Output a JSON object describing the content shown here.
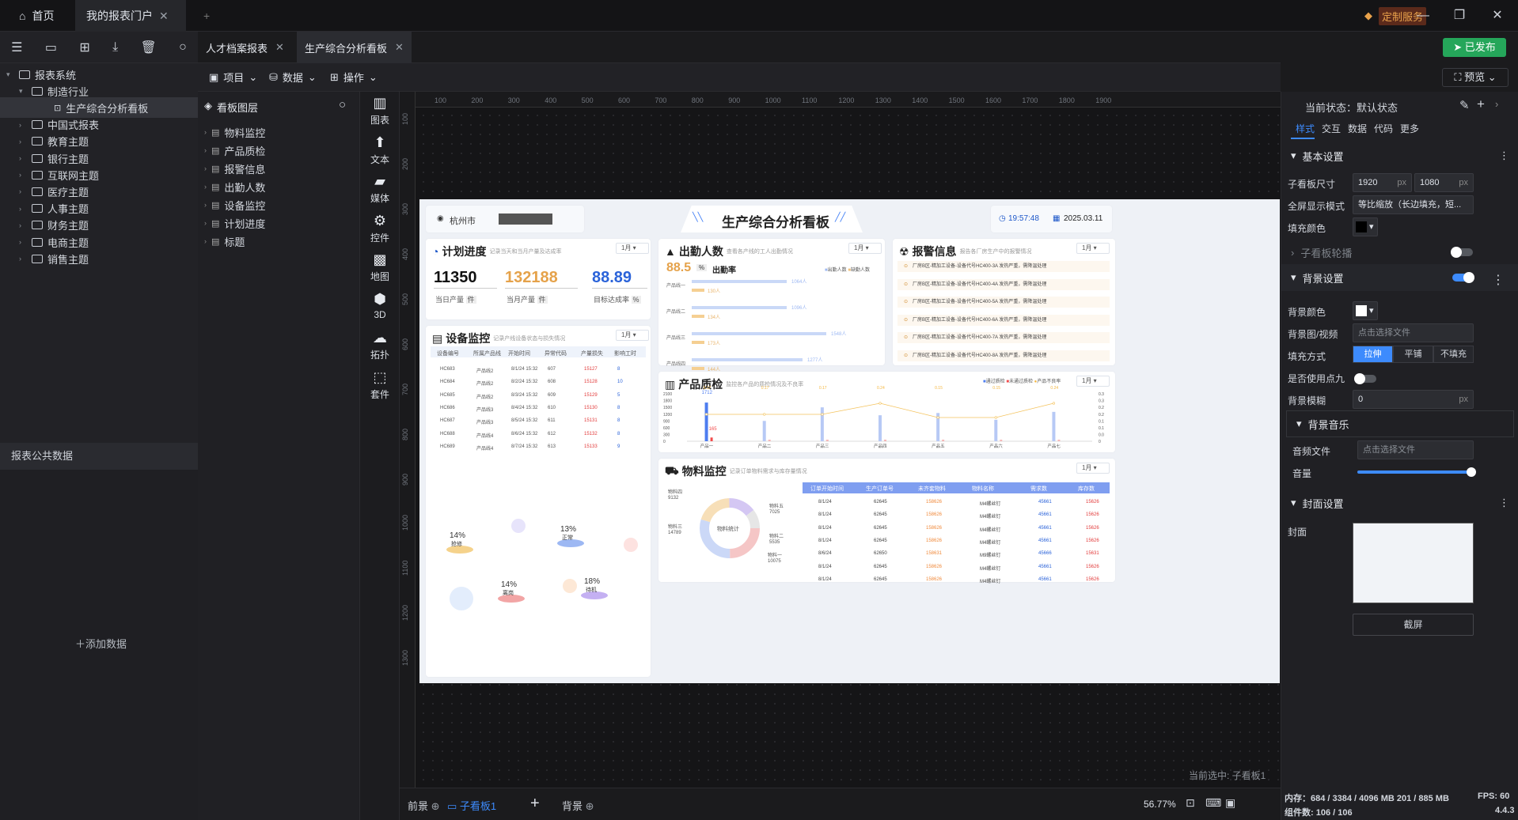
{
  "titlebar": {
    "home": "首页",
    "tab": "我的报表门户",
    "custom": "定制服务"
  },
  "toolbar_left": {
    "icons": [
      "menu-icon",
      "folder-add-icon",
      "file-add-icon",
      "download-icon",
      "trash-icon",
      "search-icon"
    ]
  },
  "tree": {
    "root": "报表系统",
    "manu": "制造行业",
    "current": "生产综合分析看板",
    "items": [
      "中国式报表",
      "教育主题",
      "银行主题",
      "互联网主题",
      "医疗主题",
      "人事主题",
      "财务主题",
      "电商主题",
      "销售主题"
    ]
  },
  "public": {
    "title": "报表公共数据",
    "add": "添加数据"
  },
  "doc": {
    "tabs": [
      "人才档案报表",
      "生产综合分析看板"
    ],
    "publish": "已发布",
    "preview": "预览"
  },
  "menu": {
    "items": [
      "项目",
      "数据",
      "操作"
    ]
  },
  "layers": {
    "title": "看板图层",
    "items": [
      "物料监控",
      "产品质检",
      "报警信息",
      "出勤人数",
      "设备监控",
      "计划进度",
      "标题"
    ]
  },
  "components": [
    "图表",
    "文本",
    "媒体",
    "控件",
    "地图",
    "3D",
    "拓扑",
    "套件"
  ],
  "ruler": {
    "h": [
      "100",
      "200",
      "300",
      "400",
      "500",
      "600",
      "700",
      "800",
      "900",
      "1000",
      "1100",
      "1200",
      "1300",
      "1400",
      "1500",
      "1600",
      "1700",
      "1800",
      "1900"
    ],
    "v": [
      "100",
      "200",
      "300",
      "400",
      "500",
      "600",
      "700",
      "800",
      "900",
      "1000",
      "1100",
      "1200",
      "1300"
    ]
  },
  "dashboard": {
    "city": "杭州市",
    "title": "生产综合分析看板",
    "time": "19:57:48",
    "date": "2025.03.11",
    "month": "1月",
    "plan": {
      "title": "计划进度",
      "sub": "记录当天和当月产量及达成率",
      "v1": "11350",
      "l1": "当日产量",
      "u1": "件",
      "v2": "132188",
      "l2": "当月产量",
      "u2": "件",
      "v3": "88.89",
      "l3": "目标达成率",
      "u3": "%"
    },
    "attendance": {
      "title": "出勤人数",
      "sub": "查看各产线的工人出勤情况",
      "rate": "88.5",
      "pct": "%",
      "rate_label": "出勤率",
      "legend": [
        "出勤人数",
        "缺勤人数"
      ],
      "lines": [
        {
          "name": "产品线一",
          "v1": "1064人",
          "v2": "130人"
        },
        {
          "name": "产品线二",
          "v1": "1096人",
          "v2": "134人"
        },
        {
          "name": "产品线三",
          "v1": "1548人",
          "v2": "173人"
        },
        {
          "name": "产品线四",
          "v1": "1277人",
          "v2": "144人"
        }
      ]
    },
    "alarm": {
      "title": "报警信息",
      "sub": "报告各厂房生产中的报警情况",
      "rows": [
        "厂房B区-精加工设备-设备代号HC400-3A 发热严重，需降温处理",
        "厂房B区-精加工设备-设备代号HC400-4A 发热严重，需降温处理",
        "厂房B区-精加工设备-设备代号HC400-5A 发热严重，需降温处理",
        "厂房B区-精加工设备-设备代号HC400-6A 发热严重，需降温处理",
        "厂房B区-精加工设备-设备代号HC400-7A 发热严重，需降温处理",
        "厂房B区-精加工设备-设备代号HC400-8A 发热严重，需降温处理"
      ]
    },
    "device": {
      "title": "设备监控",
      "sub": "记录产线设备状态与损失情况",
      "headers": [
        "设备编号",
        "所属产品线",
        "开始时间",
        "异常代码",
        "产量损失",
        "影响工时"
      ],
      "rows": [
        [
          "HC683",
          "产品线2",
          "8/1/24 15:32",
          "607",
          "15127",
          "8"
        ],
        [
          "HC684",
          "产品线2",
          "8/2/24 15:32",
          "608",
          "15128",
          "10"
        ],
        [
          "HC685",
          "产品线2",
          "8/3/24 15:32",
          "609",
          "15129",
          "5"
        ],
        [
          "HC686",
          "产品线3",
          "8/4/24 15:32",
          "610",
          "15130",
          "8"
        ],
        [
          "HC687",
          "产品线3",
          "8/5/24 15:32",
          "611",
          "15131",
          "8"
        ],
        [
          "HC688",
          "产品线4",
          "8/6/24 15:32",
          "612",
          "15132",
          "8"
        ],
        [
          "HC689",
          "产品线4",
          "8/7/24 15:32",
          "613",
          "15133",
          "9"
        ]
      ],
      "bubbles": [
        {
          "p": "14%",
          "n": "抢修"
        },
        {
          "p": "13%",
          "n": "正常"
        },
        {
          "p": "14%",
          "n": "离岗"
        },
        {
          "p": "18%",
          "n": "待机"
        }
      ]
    },
    "quality": {
      "title": "产品质检",
      "sub": "监控各产品的质检情况及不良率",
      "legend": [
        "通过质检",
        "未通过质检",
        "产品不良率"
      ],
      "yl": [
        "2100",
        "1800",
        "1500",
        "1200",
        "900",
        "600",
        "300",
        "0"
      ],
      "yr": [
        "0.3",
        "0.3",
        "0.2",
        "0.2",
        "0.1",
        "0.1",
        "0.0",
        "0"
      ],
      "x": [
        "产品一",
        "产品二",
        "产品三",
        "产品四",
        "产品五",
        "产品六",
        "产品七"
      ],
      "top_label": "1712",
      "low_label": "165",
      "rates": [
        "0.17",
        "0.17",
        "0.17",
        "0.24",
        "0.15",
        "0.15",
        "0.24"
      ],
      "pass": [
        1712,
        900,
        1500,
        1150,
        1250,
        950,
        1300
      ],
      "fail": [
        165,
        30,
        50,
        40,
        60,
        50,
        55
      ],
      "rate_vals": [
        0.17,
        0.17,
        0.17,
        0.24,
        0.15,
        0.15,
        0.24
      ]
    },
    "material": {
      "title": "物料监控",
      "sub": "记录订单物料需求与库存量情况",
      "donut_center": "物料统计",
      "labels": [
        "物料四 9132",
        "物料三 14789",
        "物料五 7025",
        "物料二 5535",
        "物料一 10075"
      ],
      "headers": [
        "订单开始时间",
        "生产订单号",
        "未齐套物料",
        "物料名称",
        "需求数",
        "库存数"
      ],
      "rows": [
        [
          "8/1/24",
          "62645",
          "158626",
          "M4螺丝钉",
          "45661",
          "15626"
        ],
        [
          "8/1/24",
          "62645",
          "158626",
          "M4螺丝钉",
          "45661",
          "15626"
        ],
        [
          "8/1/24",
          "62645",
          "158626",
          "M4螺丝钉",
          "45661",
          "15626"
        ],
        [
          "8/1/24",
          "62645",
          "158626",
          "M4螺丝钉",
          "45661",
          "15626"
        ],
        [
          "8/6/24",
          "62650",
          "158631",
          "M9螺丝钉",
          "45666",
          "15631"
        ],
        [
          "8/1/24",
          "62645",
          "158626",
          "M4螺丝钉",
          "45661",
          "15626"
        ],
        [
          "8/1/24",
          "62645",
          "158626",
          "M4螺丝钉",
          "45661",
          "15626"
        ]
      ]
    }
  },
  "canvas": {
    "selected": "当前选中: 子看板1"
  },
  "bottombar": {
    "tabs": [
      "前景",
      "子看板1",
      "背景"
    ],
    "zoom": "56.77%",
    "memory": "内存：",
    "mem_val": "684 / 3384 / 4096 MB  201 / 885 MB",
    "fps": "FPS:",
    "fps_val": "60",
    "comp": "组件数: 106 / 106",
    "version": "4.4.3"
  },
  "right": {
    "state": "当前状态：",
    "state_val": "默认状态",
    "tabs": [
      "样式",
      "交互",
      "数据",
      "代码",
      "更多"
    ],
    "basic": "基本设置",
    "size_label": "子看板尺寸",
    "w": "1920",
    "h": "1080",
    "px": "px",
    "fullscreen": "全屏显示模式",
    "fullscreen_val": "等比缩放（长边填充，短...",
    "fill_color": "填充颜色",
    "carousel": "子看板轮播",
    "bg_settings": "背景设置",
    "bg_color": "背景颜色",
    "bg_media": "背景图/视频",
    "choose": "点击选择文件",
    "fill_mode": "填充方式",
    "fill_opts": [
      "拉伸",
      "平铺",
      "不填充"
    ],
    "dot9": "是否使用点九",
    "blur": "背景模糊",
    "blur_val": "0",
    "music": "背景音乐",
    "audio": "音频文件",
    "volume": "音量",
    "cover_settings": "封面设置",
    "cover": "封面",
    "screenshot": "截屏"
  }
}
